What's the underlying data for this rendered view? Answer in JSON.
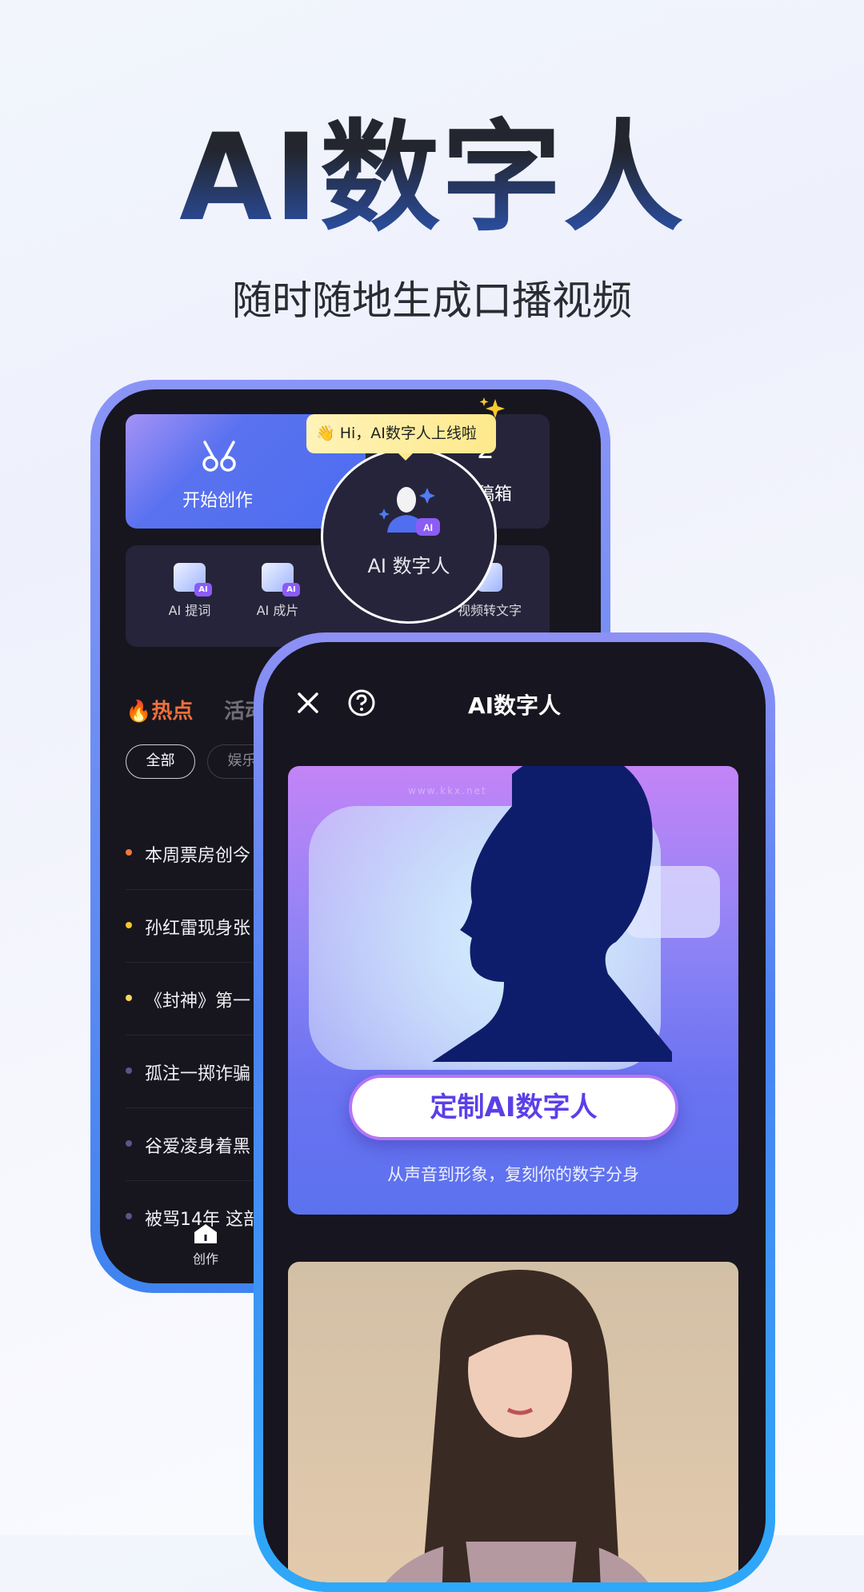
{
  "hero": {
    "title": "AI数字人",
    "subtitle": "随时随地生成口播视频"
  },
  "back_phone": {
    "create_card": {
      "label": "开始创作",
      "icon": "scissors-icon"
    },
    "drafts_card": {
      "count": "2",
      "label": "草稿箱"
    },
    "tooltip": {
      "emoji": "👋",
      "text": "Hi，AI数字人上线啦"
    },
    "featured": {
      "label": "AI 数字人",
      "icon": "digital-human-icon"
    },
    "tools": [
      {
        "label": "AI 提词"
      },
      {
        "label": "AI 成片"
      },
      {
        "label": "视频转文字"
      }
    ],
    "tabs": [
      {
        "label": "热点"
      },
      {
        "label": "活动"
      }
    ],
    "chips": [
      {
        "label": "全部"
      },
      {
        "label": "娱乐"
      }
    ],
    "news": [
      {
        "text": "本周票房创今",
        "dot": "#f0783c"
      },
      {
        "text": "孙红雷现身张",
        "dot": "#f7c531"
      },
      {
        "text": "《封神》第一",
        "dot": "#f5d75a"
      },
      {
        "text": "孤注一掷诈骗",
        "dot": "#5a5587"
      },
      {
        "text": "谷爱凌身着黑",
        "dot": "#5a5587"
      },
      {
        "text": "被骂14年 这部",
        "dot": "#5a5587"
      }
    ],
    "bottom_nav": [
      {
        "label": "创作",
        "icon": "home-icon"
      }
    ]
  },
  "front_phone": {
    "header": {
      "title": "AI数字人",
      "close_icon": "close-icon",
      "help_icon": "help-icon"
    },
    "banner": {
      "button": "定制AI数字人",
      "caption": "从声音到形象，复刻你的数字分身"
    },
    "watermark": "www.kkx.net"
  },
  "colors": {
    "accent": "#4b6df0",
    "hot": "#f0703a",
    "button_text": "#5b3fe8"
  }
}
